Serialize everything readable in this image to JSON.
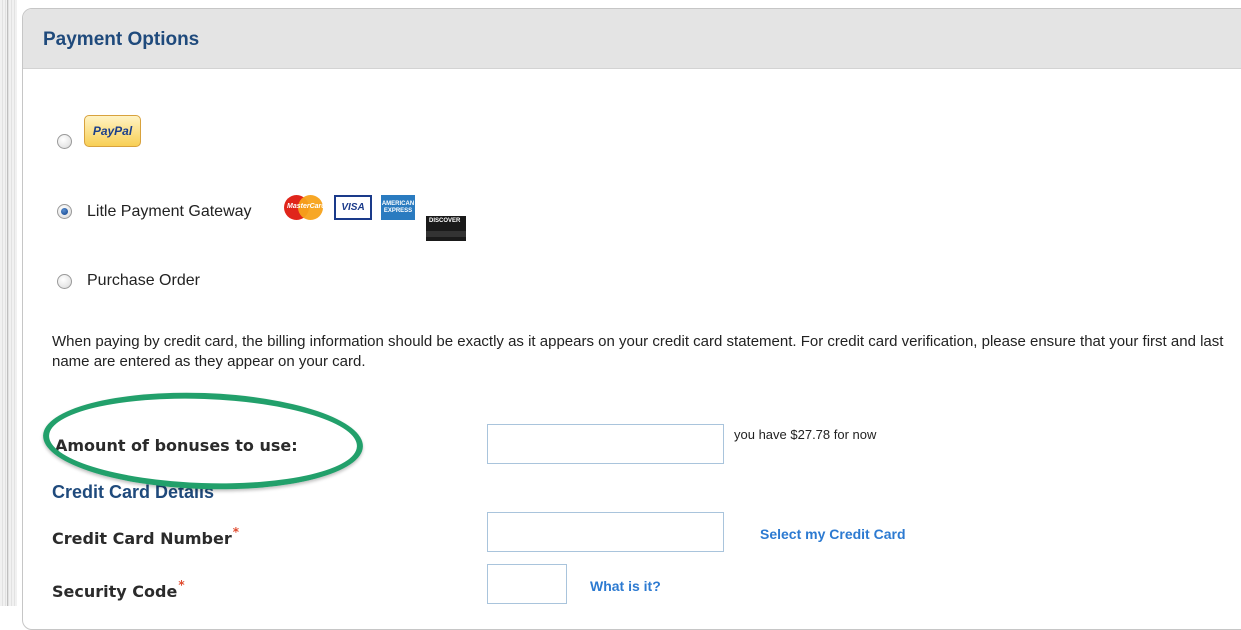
{
  "panel": {
    "title": "Payment Options"
  },
  "payment_options": [
    {
      "label": "",
      "icon": "paypal-logo",
      "selected": false
    },
    {
      "label": "Litle Payment Gateway",
      "icons": [
        "mastercard-icon",
        "visa-icon",
        "amex-icon",
        "discover-icon"
      ],
      "selected": true
    },
    {
      "label": "Purchase Order",
      "selected": false
    }
  ],
  "logos": {
    "paypal": "PayPal",
    "mastercard": "MasterCard",
    "visa": "VISA",
    "amex": "AMERICAN EXPRESS",
    "discover": "DISCOVER"
  },
  "info_text": "When paying by credit card, the billing information should be exactly as it appears on your credit card statement. For credit card verification, please ensure that your first and last name are entered as they appear on your card.",
  "bonuses": {
    "label": "Amount of bonuses to use:",
    "value": "",
    "hint": "you have $27.78 for now"
  },
  "credit_card_section": {
    "heading": "Credit Card Details",
    "card_number_label": "Credit Card Number",
    "card_number_value": "",
    "select_card_link": "Select my Credit Card",
    "security_code_label": "Security Code",
    "security_code_value": "",
    "what_is_it_link": "What is it?",
    "required_mark": "*"
  },
  "colors": {
    "header_bg": "#e4e4e4",
    "title": "#1f4a7c",
    "link": "#2c7ad1",
    "required": "#e04b2f",
    "annotation": "#22a06b"
  }
}
